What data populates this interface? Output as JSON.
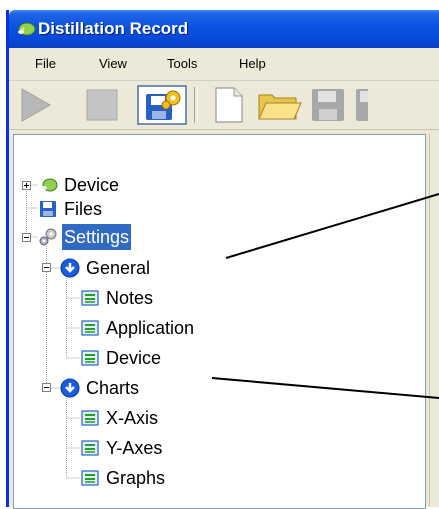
{
  "window": {
    "title": "Distillation Record"
  },
  "menu": [
    "File",
    "View",
    "Tools",
    "Help"
  ],
  "icons": {
    "app": "leaf-icon",
    "play": "play-icon",
    "stop": "stop-icon",
    "save_settings": "save-gear-icon",
    "new": "new-document-icon",
    "open": "open-folder-icon",
    "save": "floppy-disk-icon",
    "save_as": "floppy-disk-icon"
  },
  "tree": {
    "device": "Device",
    "files": "Files",
    "settings": "Settings",
    "general": "General",
    "notes": "Notes",
    "application": "Application",
    "general_device": "Device",
    "charts": "Charts",
    "xaxis": "X-Axis",
    "yaxes": "Y-Axes",
    "graphs": "Graphs"
  },
  "colors": {
    "selection": "#316ac5",
    "titlebar": "#0a52e0"
  }
}
